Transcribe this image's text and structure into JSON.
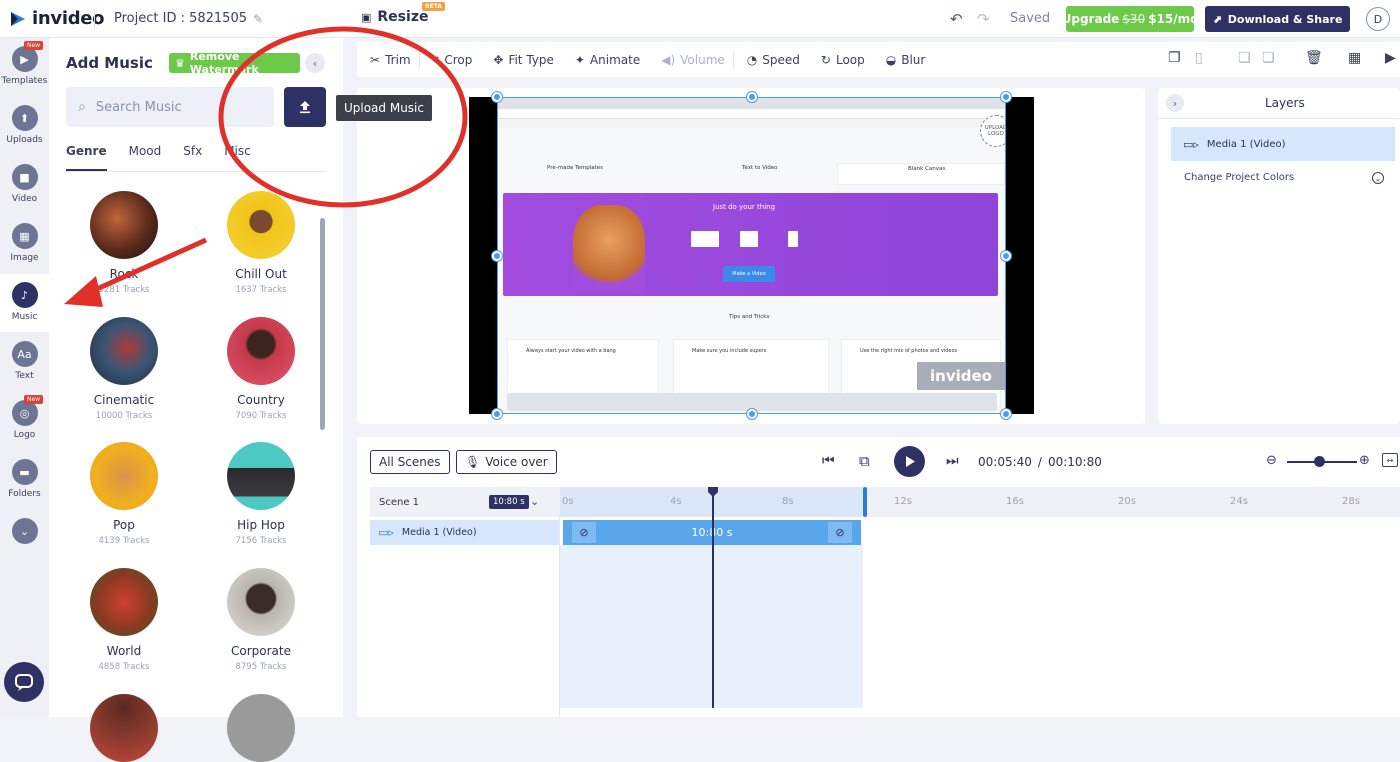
{
  "topbar": {
    "brand": "invideo",
    "project_id": "Project ID : 5821505",
    "resize_label": "Resize",
    "beta_badge": "BETA",
    "saved": "Saved",
    "upgrade_old": "$30",
    "upgrade_label": "Upgrade",
    "upgrade_price": "$15/mo",
    "download_label": "Download & Share",
    "avatar_initial": "D"
  },
  "rail": {
    "items": [
      {
        "label": "Templates",
        "icon": "templates-icon",
        "badge": "New"
      },
      {
        "label": "Uploads",
        "icon": "upload-icon"
      },
      {
        "label": "Video",
        "icon": "video-icon"
      },
      {
        "label": "Image",
        "icon": "image-icon"
      },
      {
        "label": "Music",
        "icon": "music-icon"
      },
      {
        "label": "Text",
        "icon": "text-icon",
        "glyph": "Aa"
      },
      {
        "label": "Logo",
        "icon": "logo-icon",
        "badge": "New"
      },
      {
        "label": "Folders",
        "icon": "folder-icon"
      }
    ]
  },
  "panel": {
    "title": "Add Music",
    "remove_watermark": "Remove Watermark",
    "search_placeholder": "Search Music",
    "tabs": [
      "Genre",
      "Mood",
      "Sfx",
      "Misc"
    ],
    "genres": [
      {
        "name": "Rock",
        "tracks": "5281 Tracks"
      },
      {
        "name": "Chill Out",
        "tracks": "1637 Tracks"
      },
      {
        "name": "Cinematic",
        "tracks": "10000 Tracks"
      },
      {
        "name": "Country",
        "tracks": "7090 Tracks"
      },
      {
        "name": "Pop",
        "tracks": "4139 Tracks"
      },
      {
        "name": "Hip Hop",
        "tracks": "7156 Tracks"
      },
      {
        "name": "World",
        "tracks": "4858 Tracks"
      },
      {
        "name": "Corporate",
        "tracks": "8795 Tracks"
      }
    ]
  },
  "tooltip": "Upload Music",
  "toolbar": {
    "trim": "Trim",
    "crop": "Crop",
    "fit_type": "Fit Type",
    "animate": "Animate",
    "volume": "Volume",
    "speed": "Speed",
    "loop": "Loop",
    "blur": "Blur"
  },
  "canvas": {
    "tab_option_1": "Pre-made Templates",
    "tab_option_2": "Text to Video",
    "tab_option_3": "Blank Canvas",
    "hero_title": "Just do your thing",
    "hero_button": "Make a Video",
    "tips_title": "Tips and Tricks",
    "tip1": "Always start your video with a bang",
    "tip2": "Make sure you include supers",
    "tip3": "Use the right mix of photos and videos",
    "logo_placeholder": "UPLOAD LOGO",
    "watermark": "invideo"
  },
  "layers": {
    "title": "Layers",
    "item": "Media 1 (Video)",
    "change_colors": "Change Project Colors"
  },
  "timeline": {
    "all_scenes": "All Scenes",
    "voice_over": "Voice over",
    "current_time": "00:05:40",
    "separator": "/",
    "total_time": "00:10:80",
    "scene_label": "Scene 1",
    "scene_duration": "10:80 s",
    "media_label": "Media 1 (Video)",
    "clip_duration": "10:80 s",
    "ticks": [
      "0s",
      "4s",
      "8s",
      "12s",
      "16s",
      "20s",
      "24s",
      "28s"
    ]
  },
  "colors": {
    "brand_navy": "#2d3163",
    "accent_green": "#6cc94a",
    "selection_blue": "#4c9be8",
    "annotation_red": "#e0302a"
  }
}
